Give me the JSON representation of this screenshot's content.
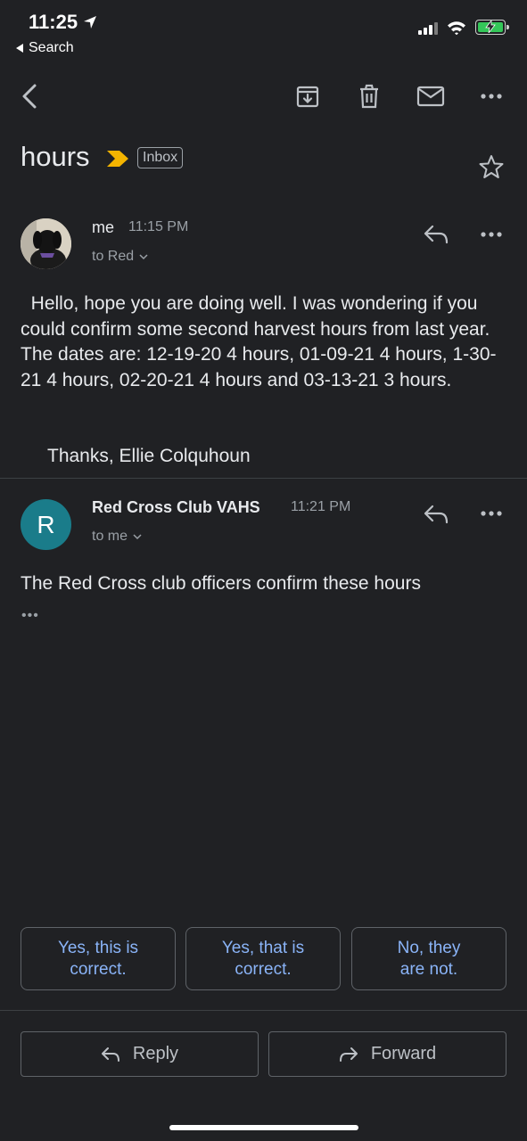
{
  "status_bar": {
    "time": "11:25",
    "back_app": "Search"
  },
  "colors": {
    "background": "#202124",
    "accent": "#8ab4f8",
    "label_chip": "#f4b400",
    "avatar_r": "#1a7c8a",
    "battery": "#34c759"
  },
  "icons": [
    "back-arrow-icon",
    "archive-icon",
    "trash-icon",
    "mail-icon",
    "more-icon",
    "star-icon",
    "reply-icon",
    "forward-icon",
    "label-important-icon",
    "chevron-down-icon"
  ],
  "thread": {
    "subject": "hours",
    "label": "Inbox"
  },
  "messages": [
    {
      "sender": "me",
      "time": "11:15 PM",
      "to": "to Red",
      "body": "  Hello, hope you are doing well. I was wondering if you could confirm some second harvest hours from last year. The dates are: 12-19-20 4 hours, 01-09-21 4 hours, 1-30-21 4 hours, 02-20-21 4 hours and 03-13-21 3 hours.",
      "signature": "Thanks, Ellie Colquhoun"
    },
    {
      "sender": "Red Cross Club VAHS",
      "avatar_letter": "R",
      "time": "11:21 PM",
      "to": "to me",
      "body": "The Red Cross club officers confirm these hours",
      "trimmed": "•••"
    }
  ],
  "smart_replies": [
    {
      "label": "Yes, this is correct."
    },
    {
      "label": "Yes, that is correct."
    },
    {
      "label": "No, they are not."
    }
  ],
  "actions": {
    "reply": "Reply",
    "forward": "Forward"
  }
}
